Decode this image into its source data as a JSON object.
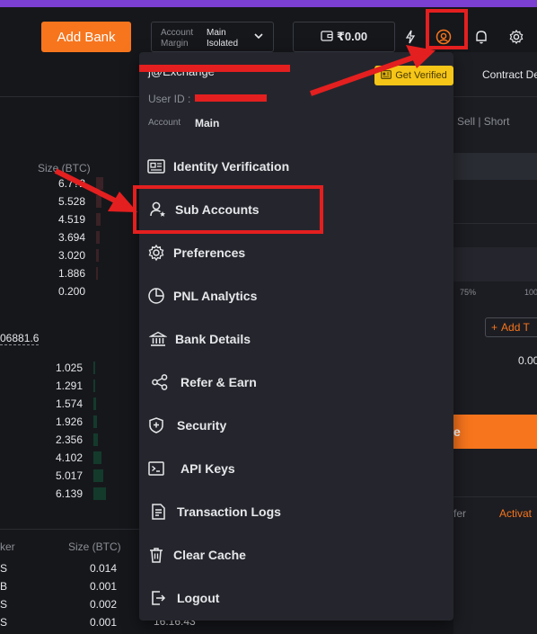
{
  "header": {
    "add_bank_label": "Add Bank",
    "account_key": "Account",
    "margin_key": "Margin",
    "account_value": "Main",
    "margin_value": "Isolated",
    "balance": "₹0.00"
  },
  "orderbook": {
    "size_header": "Size (BTC)",
    "asks": [
      "6.7?2",
      "5.528",
      "4.519",
      "3.694",
      "3.020",
      "1.886",
      "0.200"
    ],
    "mid_price": "06881.6",
    "bids": [
      "1.025",
      "1.291",
      "1.574",
      "1.926",
      "2.356",
      "4.102",
      "5.017",
      "6.139"
    ]
  },
  "trades": {
    "col_maker": "ker",
    "col_size": "Size (BTC)",
    "rows": [
      {
        "side": "S",
        "size": "0.014"
      },
      {
        "side": "B",
        "size": "0.001"
      },
      {
        "side": "S",
        "size": "0.002"
      },
      {
        "side": "S",
        "size": "0.001"
      }
    ],
    "last_time": "16:16:43"
  },
  "right_panel": {
    "contract": "Contract De",
    "sell_short": "Sell | Short",
    "pct_75": "75%",
    "pct_100": "100",
    "add_label": "Add T",
    "value": "0.00",
    "orange_label": "e",
    "transfer": "fer",
    "activate": "Activat"
  },
  "profile_menu": {
    "email": "j@Exchange",
    "user_id_label": "User ID :",
    "account_label": "Account",
    "account_value": "Main",
    "verify_label": "Get Verified",
    "items": [
      {
        "label": "Identity Verification",
        "icon": "id-card-icon"
      },
      {
        "label": "Sub Accounts",
        "icon": "sub-account-icon"
      },
      {
        "label": "Preferences",
        "icon": "gear-icon"
      },
      {
        "label": "PNL Analytics",
        "icon": "pie-chart-icon"
      },
      {
        "label": "Bank Details",
        "icon": "bank-icon"
      },
      {
        "label": "Refer & Earn",
        "icon": "share-icon"
      },
      {
        "label": "Security",
        "icon": "shield-icon"
      },
      {
        "label": "API Keys",
        "icon": "terminal-icon"
      },
      {
        "label": "Transaction Logs",
        "icon": "document-icon"
      },
      {
        "label": "Clear Cache",
        "icon": "trash-icon"
      },
      {
        "label": "Logout",
        "icon": "logout-icon"
      }
    ]
  },
  "colors": {
    "accent": "#f7751d",
    "annotation": "#e41f1f",
    "badge": "#f5c518",
    "top_bar": "#7b3fd1"
  }
}
